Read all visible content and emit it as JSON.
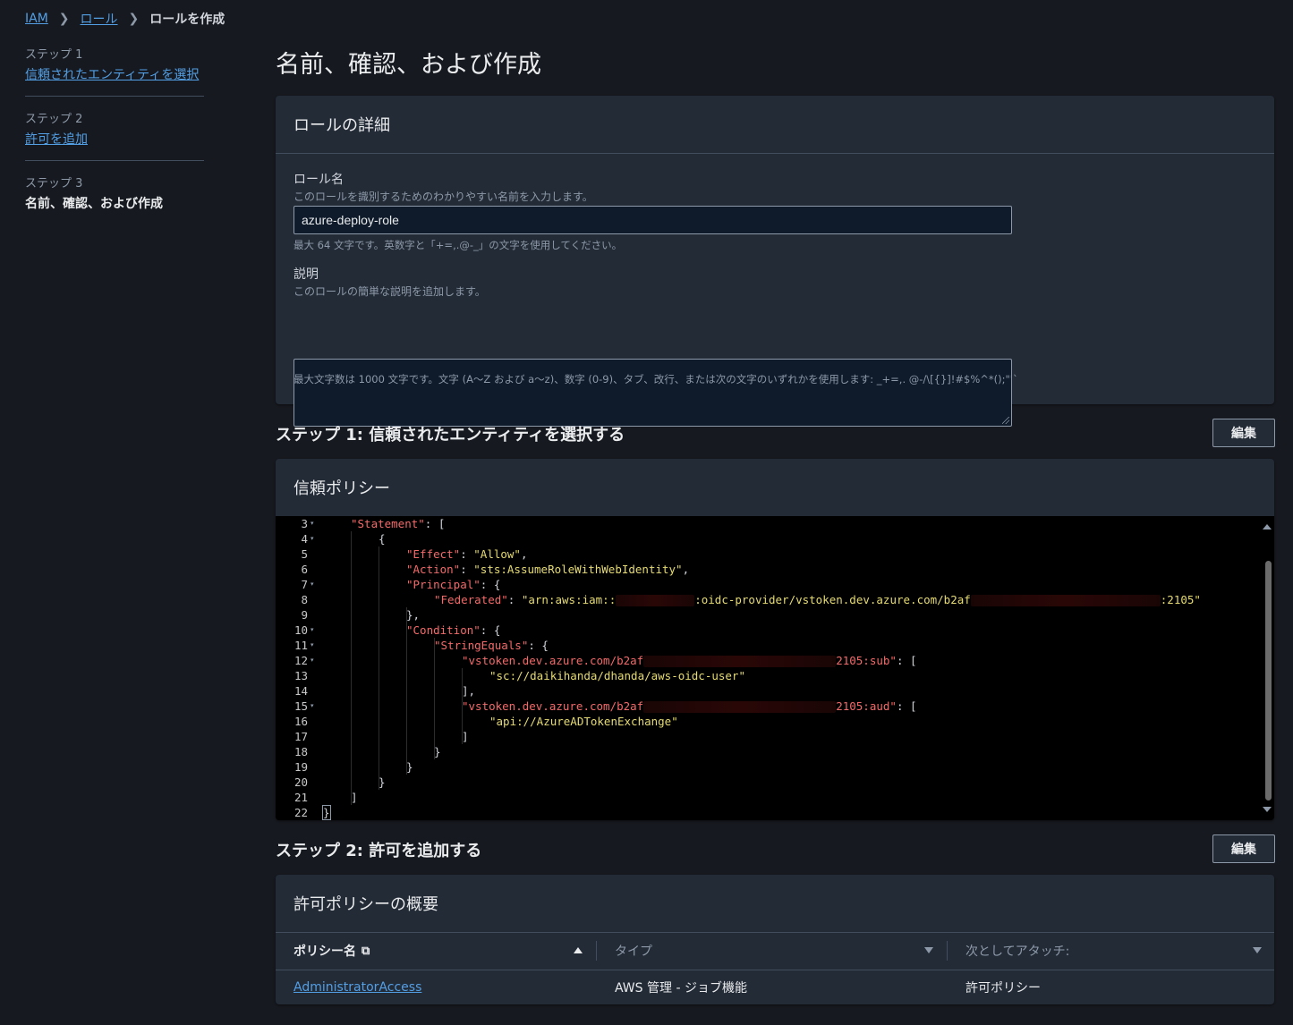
{
  "breadcrumb": {
    "items": [
      "IAM",
      "ロール"
    ],
    "current": "ロールを作成"
  },
  "steps": [
    {
      "number": "ステップ 1",
      "name": "信頼されたエンティティを選択"
    },
    {
      "number": "ステップ 2",
      "name": "許可を追加"
    },
    {
      "number": "ステップ 3",
      "name": "名前、確認、および作成"
    }
  ],
  "page_title": "名前、確認、および作成",
  "role_details": {
    "header": "ロールの詳細",
    "role_name_label": "ロール名",
    "role_name_desc": "このロールを識別するためのわかりやすい名前を入力します。",
    "role_name_value": "azure-deploy-role",
    "role_name_hint": "最大 64 文字です。英数字と「+=,.@-_」の文字を使用してください。",
    "description_label": "説明",
    "description_desc": "このロールの簡単な説明を追加します。",
    "description_value": "",
    "description_hint": "最大文字数は 1000 文字です。文字 (A〜Z および a〜z)、数字 (0-9)、タブ、改行、または次の文字のいずれかを使用します: _+=,. @-/\\[{}]!#$%^*();\"'`"
  },
  "step1_section": {
    "title": "ステップ 1: 信頼されたエンティティを選択する",
    "edit_label": "編集",
    "panel_header": "信頼ポリシー"
  },
  "trust_policy": {
    "line_numbers": [
      "3",
      "4",
      "5",
      "6",
      "7",
      "8",
      "9",
      "10",
      "11",
      "12",
      "13",
      "14",
      "15",
      "16",
      "17",
      "18",
      "19",
      "20",
      "21",
      "22"
    ],
    "fold_lines": [
      "3",
      "4",
      "7",
      "10",
      "11",
      "12",
      "15"
    ],
    "statement_key": "\"Statement\"",
    "effect_key": "\"Effect\"",
    "effect_value": "\"Allow\"",
    "action_key": "\"Action\"",
    "action_value": "\"sts:AssumeRoleWithWebIdentity\"",
    "principal_key": "\"Principal\"",
    "federated_key": "\"Federated\"",
    "federated_value_start": "\"arn:aws:iam::",
    "federated_value_mid": ":oidc-provider/vstoken.dev.azure.com/b2af",
    "federated_value_end": ":2105\"",
    "condition_key": "\"Condition\"",
    "string_equals_key": "\"StringEquals\"",
    "sub_key_start": "\"vstoken.dev.azure.com/b2af",
    "sub_key_end": "2105:sub\"",
    "sub_value": "\"sc://daikihanda/dhanda/aws-oidc-user\"",
    "aud_key_start": "\"vstoken.dev.azure.com/b2af",
    "aud_key_end": "2105:aud\"",
    "aud_value": "\"api://AzureADTokenExchange\""
  },
  "step2_section": {
    "title": "ステップ 2: 許可を追加する",
    "edit_label": "編集",
    "panel_header": "許可ポリシーの概要"
  },
  "permissions_table": {
    "columns": [
      "ポリシー名",
      "タイプ",
      "次としてアタッチ:"
    ],
    "rows": [
      {
        "policy_name": "AdministratorAccess",
        "type": "AWS 管理 - ジョブ機能",
        "attached_as": "許可ポリシー"
      }
    ]
  },
  "colors": {
    "background": "#16191f",
    "panel": "#232b37",
    "link": "#539fe5",
    "json_key": "#f36a6a",
    "json_string": "#e6db74"
  }
}
